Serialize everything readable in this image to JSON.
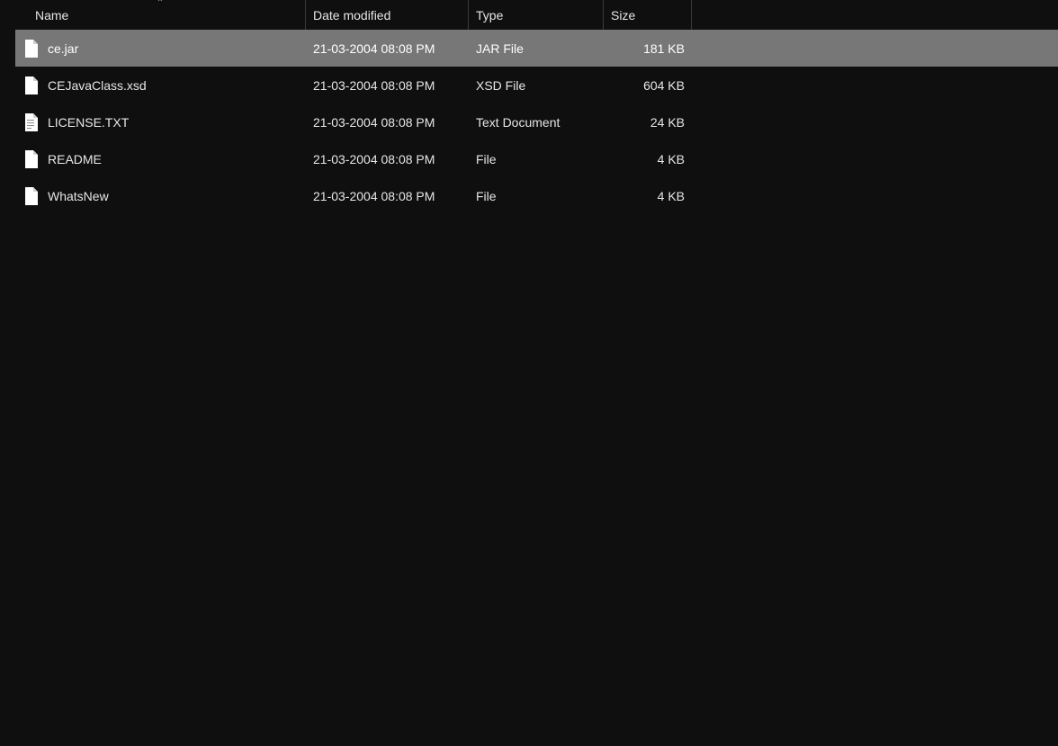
{
  "columns": {
    "name": "Name",
    "date": "Date modified",
    "type": "Type",
    "size": "Size"
  },
  "sort_indicator": "⌃",
  "files": [
    {
      "name": "ce.jar",
      "date": "21-03-2004 08:08 PM",
      "type": "JAR File",
      "size": "181 KB",
      "selected": true,
      "icon": "blank"
    },
    {
      "name": "CEJavaClass.xsd",
      "date": "21-03-2004 08:08 PM",
      "type": "XSD File",
      "size": "604 KB",
      "selected": false,
      "icon": "blank"
    },
    {
      "name": "LICENSE.TXT",
      "date": "21-03-2004 08:08 PM",
      "type": "Text Document",
      "size": "24 KB",
      "selected": false,
      "icon": "text"
    },
    {
      "name": "README",
      "date": "21-03-2004 08:08 PM",
      "type": "File",
      "size": "4 KB",
      "selected": false,
      "icon": "blank"
    },
    {
      "name": "WhatsNew",
      "date": "21-03-2004 08:08 PM",
      "type": "File",
      "size": "4 KB",
      "selected": false,
      "icon": "blank"
    }
  ]
}
